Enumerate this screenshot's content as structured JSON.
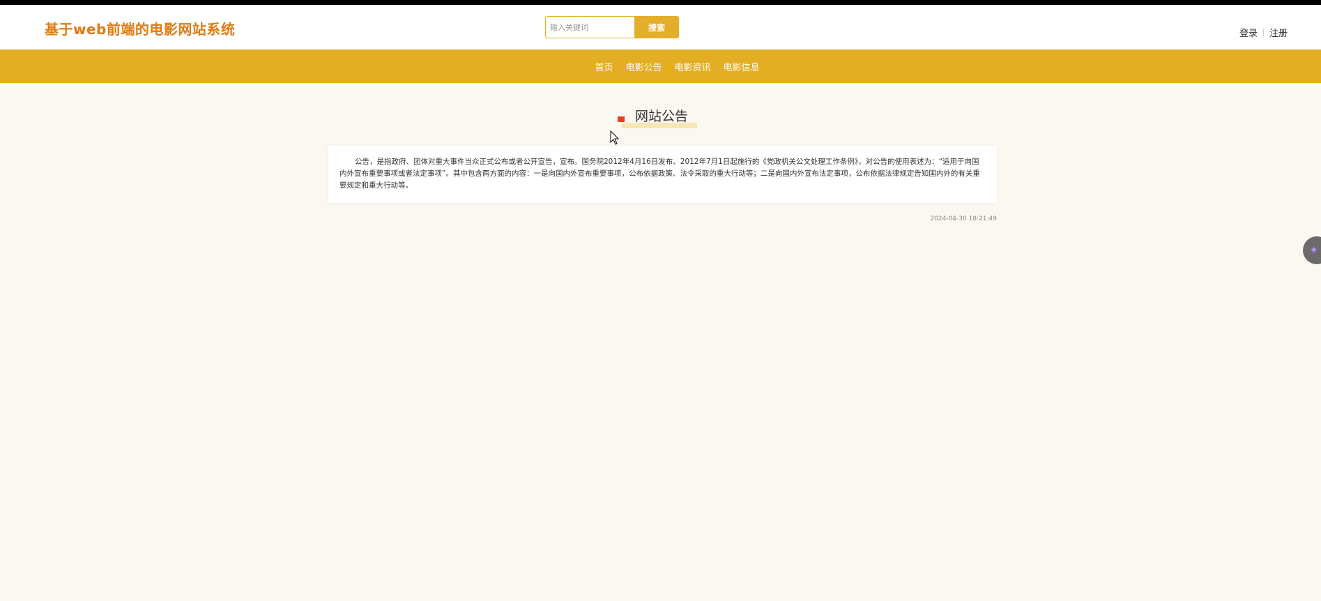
{
  "header": {
    "site_title": "基于web前端的电影网站系统",
    "search_placeholder": "输入关键词",
    "search_button": "搜索",
    "login": "登录",
    "register": "注册"
  },
  "nav": {
    "items": [
      "首页",
      "电影公告",
      "电影资讯",
      "电影信息"
    ]
  },
  "notice": {
    "section_title": "网站公告",
    "body": "公告，是指政府、团体对重大事件当众正式公布或者公开宣告，宣布。国务院2012年4月16日发布、2012年7月1日起施行的《党政机关公文处理工作条例》，对公告的使用表述为：“适用于向国内外宣布重要事项或者法定事项”。其中包含两方面的内容：一是向国内外宣布重要事项，公布依据政策、法令采取的重大行动等；二是向国内外宣布法定事项，公布依据法律规定告知国内外的有关重要规定和重大行动等。",
    "timestamp": "2024-04-30 18:21:49"
  },
  "colors": {
    "accent": "#e3ae23",
    "title_orange": "#e07b15",
    "marker_red": "#e0451a",
    "background": "#faf8f0"
  },
  "icons": {
    "logo": "crescent-moon-icon",
    "floating": "assistant-float-icon"
  }
}
